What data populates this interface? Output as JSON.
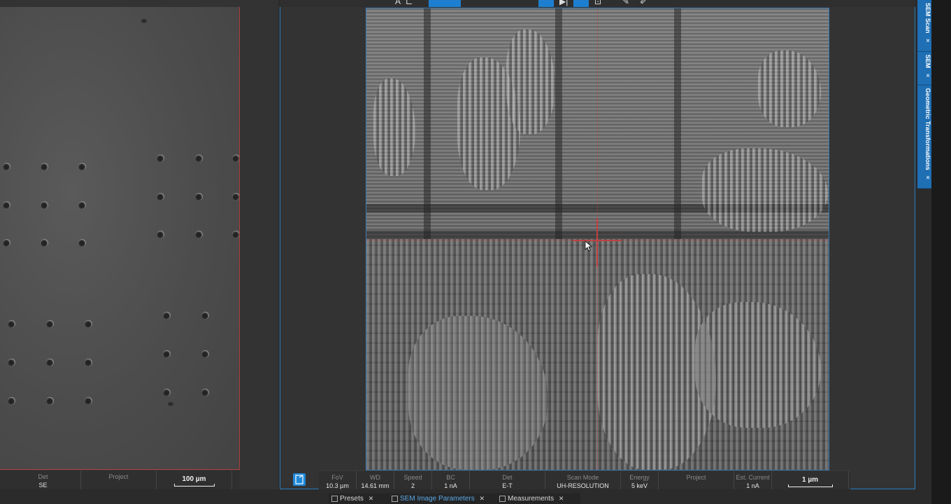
{
  "left_panel": {
    "status": {
      "det_label": "Det",
      "det_value": "SE",
      "project_label": "Project",
      "project_value": "",
      "scalebar": "100 µm"
    }
  },
  "right_panel": {
    "status": {
      "fov_label": "FoV",
      "fov_value": "10.3 µm",
      "wd_label": "WD",
      "wd_value": "14.61 mm",
      "speed_label": "Speed",
      "speed_value": "2",
      "bc_label": "BC",
      "bc_value": "1 nA",
      "det_label": "Det",
      "det_value": "E-T",
      "scanmode_label": "Scan Mode",
      "scanmode_value": "UH-RESOLUTION",
      "energy_label": "Energy",
      "energy_value": "5 keV",
      "project_label": "Project",
      "project_value": "",
      "current_label": "Est. Current",
      "current_value": "1 nA",
      "scalebar": "1 µm"
    }
  },
  "side_tabs": [
    {
      "label": "SEM Scan"
    },
    {
      "label": "SEM"
    },
    {
      "label": "Geometric Transformations"
    }
  ],
  "bottom_tabs": [
    {
      "label": "Presets",
      "active": false
    },
    {
      "label": "SEM Image Parameters",
      "active": true
    },
    {
      "label": "Measurements",
      "active": false
    }
  ],
  "colors": {
    "accent": "#1e7fd0",
    "selection_border": "#b04040"
  }
}
